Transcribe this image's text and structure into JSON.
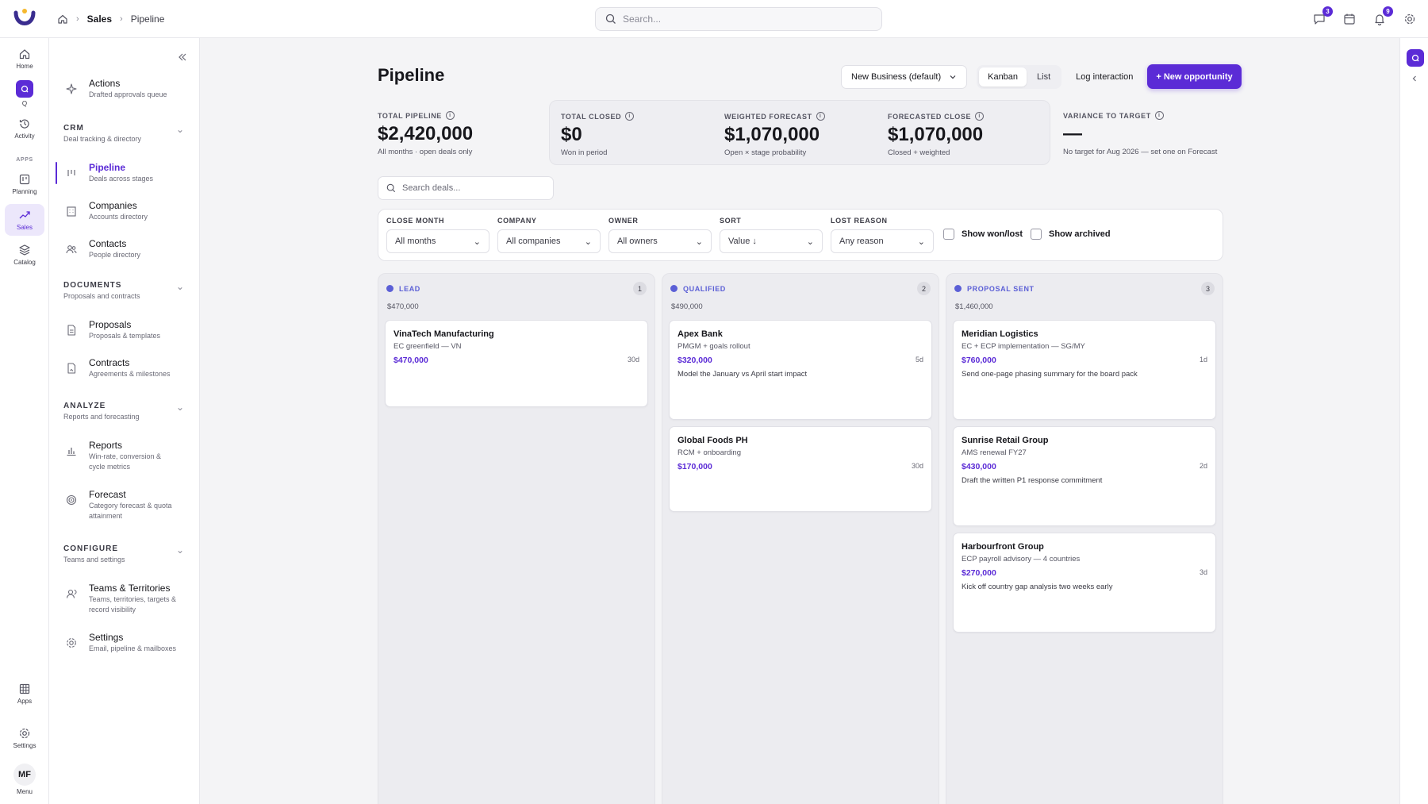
{
  "breadcrumb": {
    "section": "Sales",
    "page": "Pipeline"
  },
  "search": {
    "placeholder": "Search..."
  },
  "top_badges": {
    "messages": "3",
    "notifications": "9"
  },
  "rail": {
    "home": "Home",
    "q": "Q",
    "activity": "Activity",
    "apps_header": "APPS",
    "planning": "Planning",
    "sales": "Sales",
    "catalog": "Catalog",
    "apps": "Apps",
    "settings": "Settings",
    "avatar": "MF",
    "menu": "Menu"
  },
  "sidenav": {
    "actions": {
      "title": "Actions",
      "sub": "Drafted approvals queue"
    },
    "crm": {
      "header": "CRM",
      "desc": "Deal tracking & directory"
    },
    "pipeline": {
      "title": "Pipeline",
      "sub": "Deals across stages"
    },
    "companies": {
      "title": "Companies",
      "sub": "Accounts directory"
    },
    "contacts": {
      "title": "Contacts",
      "sub": "People directory"
    },
    "documents": {
      "header": "DOCUMENTS",
      "desc": "Proposals and contracts"
    },
    "proposals": {
      "title": "Proposals",
      "sub": "Proposals & templates"
    },
    "contracts": {
      "title": "Contracts",
      "sub": "Agreements & milestones"
    },
    "analyze": {
      "header": "ANALYZE",
      "desc": "Reports and forecasting"
    },
    "reports": {
      "title": "Reports",
      "sub": "Win-rate, conversion & cycle metrics"
    },
    "forecast": {
      "title": "Forecast",
      "sub": "Category forecast & quota attainment"
    },
    "configure": {
      "header": "CONFIGURE",
      "desc": "Teams and settings"
    },
    "teams": {
      "title": "Teams & Territories",
      "sub": "Teams, territories, targets & record visibility"
    },
    "settings": {
      "title": "Settings",
      "sub": "Email, pipeline & mailboxes"
    }
  },
  "main": {
    "title": "Pipeline",
    "pipeline_select": "New Business (default)",
    "view_kanban": "Kanban",
    "view_list": "List",
    "log_interaction": "Log interaction",
    "new_opportunity": "+ New opportunity"
  },
  "stats": {
    "total_pipeline": {
      "label": "TOTAL PIPELINE",
      "value": "$2,420,000",
      "note": "All months · open deals only"
    },
    "total_closed": {
      "label": "TOTAL CLOSED",
      "value": "$0",
      "note": "Won in period"
    },
    "weighted_forecast": {
      "label": "WEIGHTED FORECAST",
      "value": "$1,070,000",
      "note": "Open × stage probability"
    },
    "forecasted_close": {
      "label": "FORECASTED CLOSE",
      "value": "$1,070,000",
      "note": "Closed + weighted"
    },
    "variance": {
      "label": "VARIANCE TO TARGET",
      "value": "—",
      "note": "No target for Aug 2026 — set one on Forecast"
    }
  },
  "deal_search": {
    "placeholder": "Search deals..."
  },
  "filters": {
    "close_month": {
      "label": "CLOSE MONTH",
      "value": "All months"
    },
    "company": {
      "label": "COMPANY",
      "value": "All companies"
    },
    "owner": {
      "label": "OWNER",
      "value": "All owners"
    },
    "sort": {
      "label": "SORT",
      "value": "Value ↓"
    },
    "lost_reason": {
      "label": "LOST REASON",
      "value": "Any reason"
    },
    "show_won_lost": "Show won/lost",
    "show_archived": "Show archived"
  },
  "colors": {
    "accent": "#5b2bd6",
    "stage_dot": "#5b5fd6"
  },
  "columns": [
    {
      "name": "LEAD",
      "count": "1",
      "total": "$470,000",
      "cards": [
        {
          "name": "VinaTech Manufacturing",
          "sub": "EC greenfield — VN",
          "value": "$470,000",
          "age": "30d",
          "note": ""
        }
      ]
    },
    {
      "name": "QUALIFIED",
      "count": "2",
      "total": "$490,000",
      "cards": [
        {
          "name": "Apex Bank",
          "sub": "PMGM + goals rollout",
          "value": "$320,000",
          "age": "5d",
          "note": "Model the January vs April start impact"
        },
        {
          "name": "Global Foods PH",
          "sub": "RCM + onboarding",
          "value": "$170,000",
          "age": "30d",
          "note": ""
        }
      ]
    },
    {
      "name": "PROPOSAL SENT",
      "count": "3",
      "total": "$1,460,000",
      "cards": [
        {
          "name": "Meridian Logistics",
          "sub": "EC + ECP implementation — SG/MY",
          "value": "$760,000",
          "age": "1d",
          "note": "Send one-page phasing summary for the board pack"
        },
        {
          "name": "Sunrise Retail Group",
          "sub": "AMS renewal FY27",
          "value": "$430,000",
          "age": "2d",
          "note": "Draft the written P1 response commitment"
        },
        {
          "name": "Harbourfront Group",
          "sub": "ECP payroll advisory — 4 countries",
          "value": "$270,000",
          "age": "3d",
          "note": "Kick off country gap analysis two weeks early"
        }
      ]
    }
  ]
}
